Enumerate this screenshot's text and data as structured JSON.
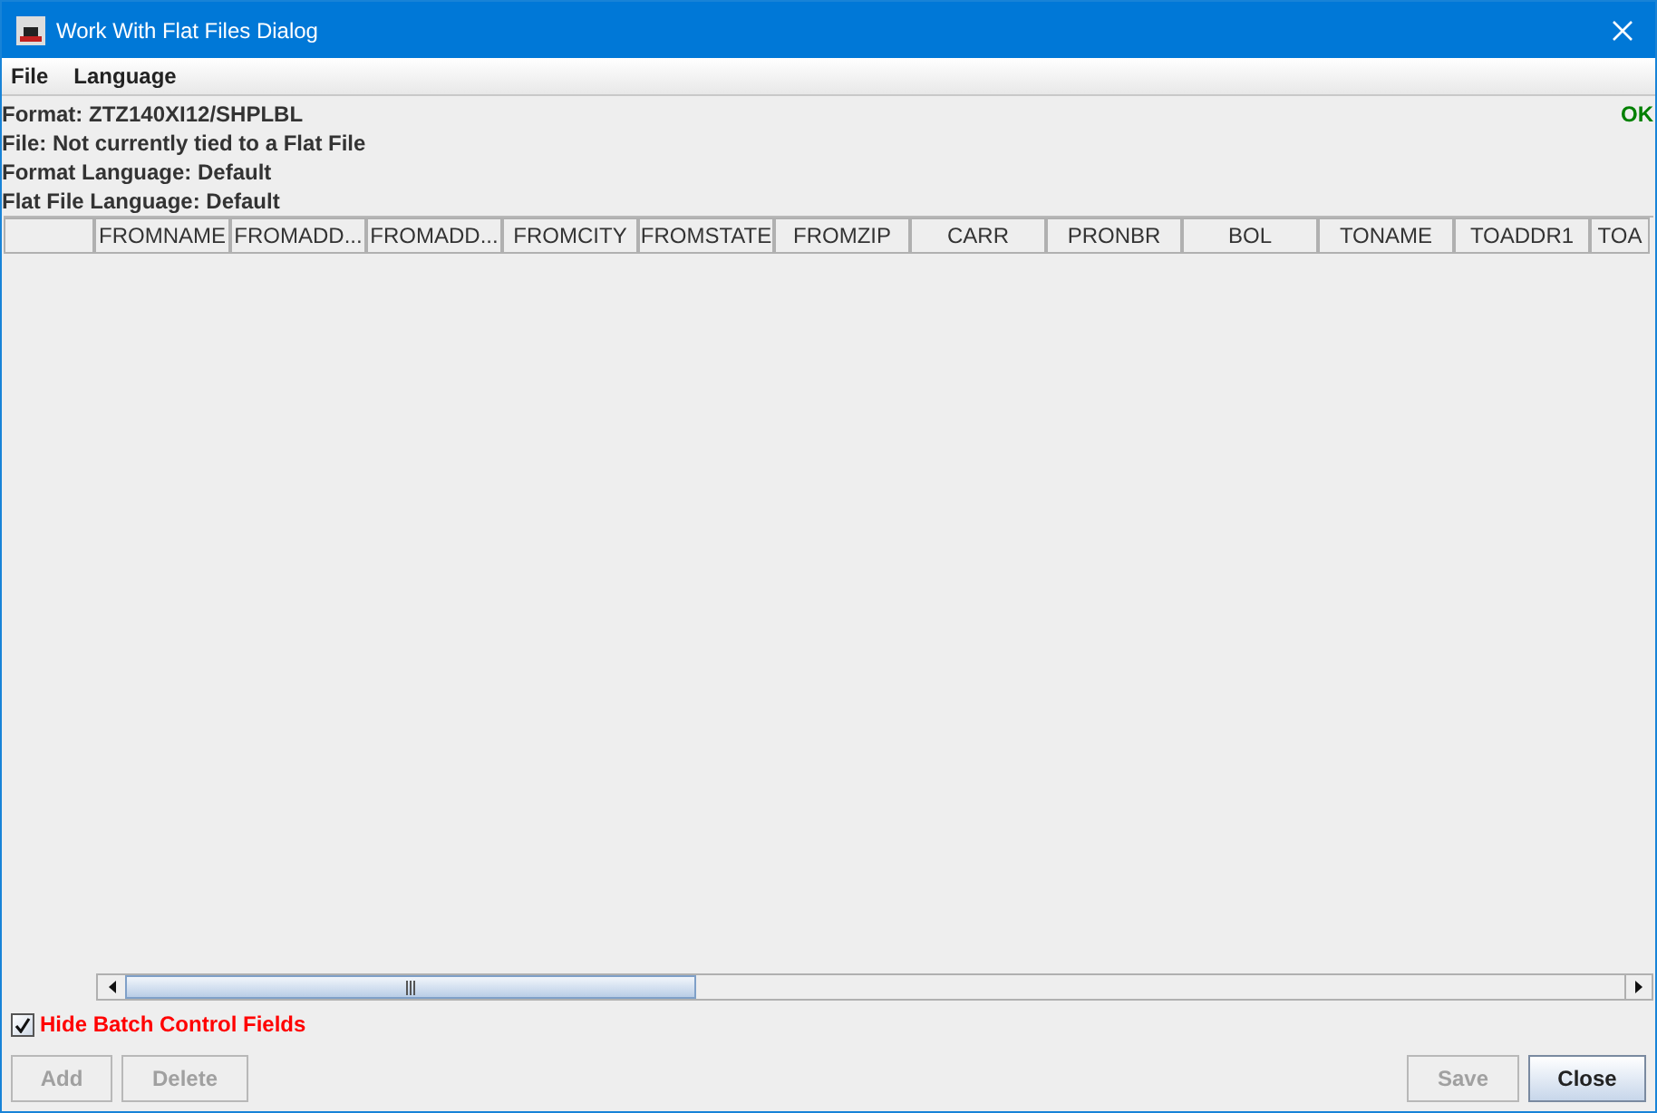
{
  "window": {
    "title": "Work With Flat Files Dialog"
  },
  "menu": [
    "File",
    "Language"
  ],
  "info_lines": [
    "Format: ZTZ140XI12/SHPLBL",
    "File: Not currently tied to a Flat File",
    "Format Language: Default",
    "Flat File Language: Default"
  ],
  "status": "OK",
  "table": {
    "columns": [
      "",
      "FROMNAME",
      "FROMADD...",
      "FROMADD...",
      "FROMCITY",
      "FROMSTATE",
      "FROMZIP",
      "CARR",
      "PRONBR",
      "BOL",
      "TONAME",
      "TOADDR1",
      "TOA"
    ]
  },
  "hide_batch": {
    "label": "Hide Batch Control Fields",
    "checked": true
  },
  "buttons_left": [
    {
      "label": "Add",
      "disabled": true
    },
    {
      "label": "Delete",
      "disabled": true
    }
  ],
  "buttons_right": [
    {
      "label": "Save",
      "disabled": true
    },
    {
      "label": "Close",
      "disabled": false
    }
  ]
}
